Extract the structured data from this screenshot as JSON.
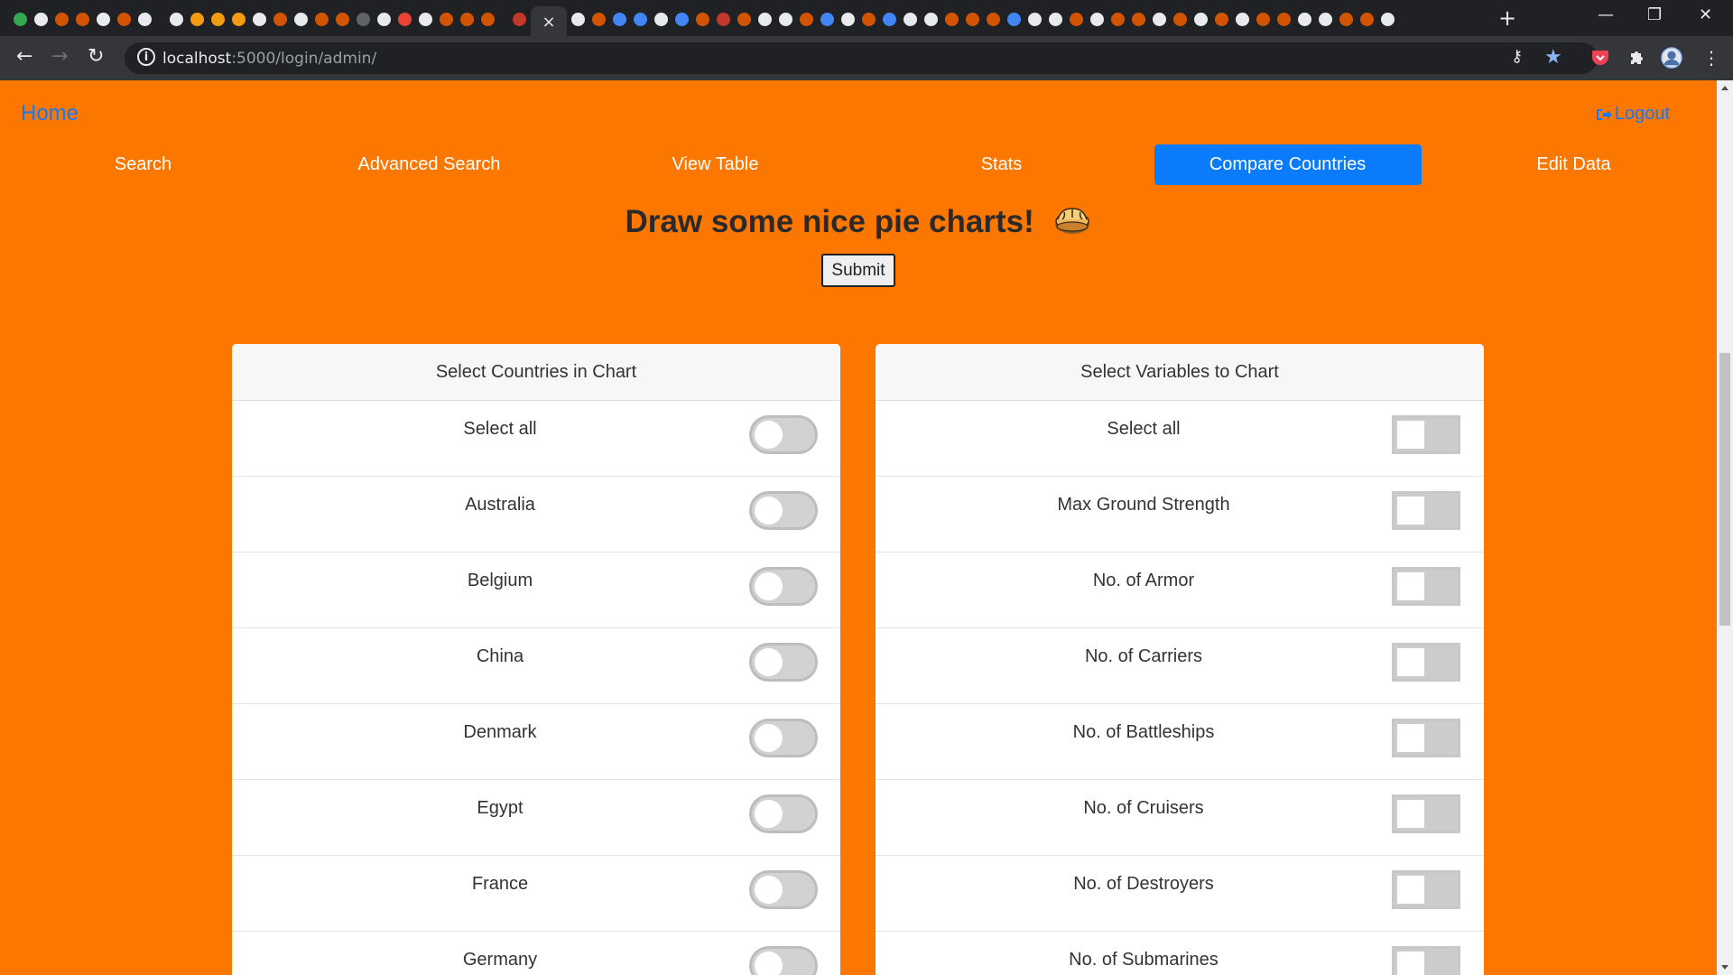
{
  "browser": {
    "url_host": "localhost",
    "url_path": ":5000/login/admin/",
    "active_tab_close": "×",
    "new_tab": "+",
    "controls": {
      "minimize": "—",
      "restore": "❐",
      "close": "✕"
    }
  },
  "page": {
    "home": "Home",
    "logout": "Logout",
    "nav": [
      "Search",
      "Advanced Search",
      "View Table",
      "Stats",
      "Compare Countries",
      "Edit Data"
    ],
    "active_nav": "Compare Countries",
    "title": "Draw some nice pie charts!",
    "submit": "Submit"
  },
  "countries_card": {
    "header": "Select Countries in Chart",
    "rows": [
      "Select all",
      "Australia",
      "Belgium",
      "China",
      "Denmark",
      "Egypt",
      "France",
      "Germany"
    ]
  },
  "variables_card": {
    "header": "Select Variables to Chart",
    "rows": [
      "Select all",
      "Max Ground Strength",
      "No. of Armor",
      "No. of Carriers",
      "No. of Battleships",
      "No. of Cruisers",
      "No. of Destroyers",
      "No. of Submarines"
    ]
  },
  "colors": {
    "page_bg": "#fb7700",
    "link": "#1679f5",
    "active_nav": "#0a7cfb"
  },
  "icons": [
    "info-icon",
    "key-icon",
    "star-icon",
    "pocket-icon",
    "puzzle-icon",
    "profile-avatar-icon",
    "kebab-menu-icon",
    "logout-icon",
    "pie-emoji-icon"
  ]
}
